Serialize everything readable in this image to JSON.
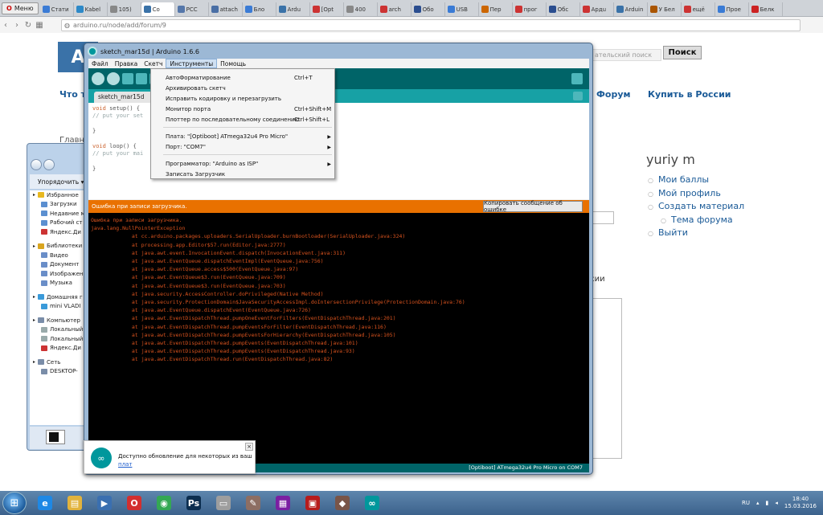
{
  "browser": {
    "menu_label": "Меню",
    "tabs": [
      {
        "label": "Стати",
        "color": "#3a7bd5"
      },
      {
        "label": "Kabel",
        "color": "#2d89c8"
      },
      {
        "label": "105)",
        "color": "#888888"
      },
      {
        "label": "Co",
        "color": "#3a72a8",
        "active": true
      },
      {
        "label": "PCC",
        "color": "#5577aa"
      },
      {
        "label": "attach",
        "color": "#4a6fa5"
      },
      {
        "label": "Бло",
        "color": "#3a7bd5"
      },
      {
        "label": "Ardu",
        "color": "#3a72a8"
      },
      {
        "label": "[Opt",
        "color": "#cc3333"
      },
      {
        "label": "400",
        "color": "#888888"
      },
      {
        "label": "arch",
        "color": "#cc3333"
      },
      {
        "label": "Обо",
        "color": "#2a4d8f"
      },
      {
        "label": "USB",
        "color": "#3a7bd5"
      },
      {
        "label": "Пер",
        "color": "#cc6600"
      },
      {
        "label": "прог",
        "color": "#cc3333"
      },
      {
        "label": "Обс",
        "color": "#2a4d8f"
      },
      {
        "label": "Ардu",
        "color": "#cc3333"
      },
      {
        "label": "Arduin",
        "color": "#3a72a8"
      },
      {
        "label": "У Бел",
        "color": "#aa5500"
      },
      {
        "label": "ещё",
        "color": "#cc3333"
      },
      {
        "label": "Прое",
        "color": "#3a7bd5"
      },
      {
        "label": "Белк",
        "color": "#cc2222"
      }
    ],
    "url": "arduino.ru/node/add/forum/9"
  },
  "page": {
    "search_hint": "ательский поиск",
    "search_button": "Поиск",
    "nav_what": "Что т",
    "nav_forum": "Форум",
    "nav_buy": "Купить в России",
    "crumb": "Главн",
    "user_name": "yuriy m",
    "user_menu": [
      "Мои баллы",
      "Мой профиль",
      "Создать материал",
      "Тема форума",
      "Выйти"
    ],
    "rossii": "осии"
  },
  "explorer": {
    "organize": "Упорядочить ▾",
    "tree": [
      {
        "label": "Избранное",
        "color": "#e8b820",
        "level": 0
      },
      {
        "label": "Загрузки",
        "color": "#5b8fd0",
        "level": 1
      },
      {
        "label": "Недавние м",
        "color": "#5b8fd0",
        "level": 1
      },
      {
        "label": "Рабочий ст",
        "color": "#5b8fd0",
        "level": 1
      },
      {
        "label": "Яндекс.Ди",
        "color": "#cc3333",
        "level": 1
      },
      {
        "label": "",
        "color": "",
        "level": -1
      },
      {
        "label": "Библиотеки",
        "color": "#d9a520",
        "level": 0
      },
      {
        "label": "Видео",
        "color": "#6a8ec8",
        "level": 1
      },
      {
        "label": "Документ",
        "color": "#6a8ec8",
        "level": 1
      },
      {
        "label": "Изображен",
        "color": "#6a8ec8",
        "level": 1
      },
      {
        "label": "Музыка",
        "color": "#6a8ec8",
        "level": 1
      },
      {
        "label": "",
        "color": "",
        "level": -1
      },
      {
        "label": "Домашняя г",
        "color": "#3a9ad9",
        "level": 0
      },
      {
        "label": "mini VLADI",
        "color": "#3a9ad9",
        "level": 1
      },
      {
        "label": "",
        "color": "",
        "level": -1
      },
      {
        "label": "Компьютер",
        "color": "#7a8da8",
        "level": 0
      },
      {
        "label": "Локальный",
        "color": "#9aa",
        "level": 1
      },
      {
        "label": "Локальный",
        "color": "#9aa",
        "level": 1
      },
      {
        "label": "Яндекс.Ди",
        "color": "#cc3333",
        "level": 1
      },
      {
        "label": "",
        "color": "",
        "level": -1
      },
      {
        "label": "Сеть",
        "color": "#7a8da8",
        "level": 0
      },
      {
        "label": "DESKTOP-",
        "color": "#7a8da8",
        "level": 1
      }
    ]
  },
  "arduino": {
    "title": "sketch_mar15d | Arduino 1.6.6",
    "menus": [
      "Файл",
      "Правка",
      "Скетч",
      "Инструменты",
      "Помощь"
    ],
    "tab": "sketch_mar15d",
    "code": [
      {
        "k": "void",
        "rest": " setup() {"
      },
      {
        "c": "  // put your set"
      },
      {
        "t": ""
      },
      {
        "t": "}"
      },
      {
        "t": ""
      },
      {
        "k": "void",
        "rest": " loop() {"
      },
      {
        "c": "  // put your mai"
      },
      {
        "t": ""
      },
      {
        "t": "}"
      }
    ],
    "error_bar": "Ошибка при записи загрузчика.",
    "copy_button": "Копировать сообщение об ошибке",
    "console": [
      "Ошибка при записи загрузчика.",
      "java.lang.NullPointerException",
      "\tat cc.arduino.packages.uploaders.SerialUploader.burnBootloader(SerialUploader.java:324)",
      "\tat processing.app.Editor$57.run(Editor.java:2777)",
      "\tat java.awt.event.InvocationEvent.dispatch(InvocationEvent.java:311)",
      "\tat java.awt.EventQueue.dispatchEventImpl(EventQueue.java:756)",
      "\tat java.awt.EventQueue.access$500(EventQueue.java:97)",
      "\tat java.awt.EventQueue$3.run(EventQueue.java:709)",
      "\tat java.awt.EventQueue$3.run(EventQueue.java:703)",
      "\tat java.security.AccessController.doPrivileged(Native Method)",
      "\tat java.security.ProtectionDomain$JavaSecurityAccessImpl.doIntersectionPrivilege(ProtectionDomain.java:76)",
      "\tat java.awt.EventQueue.dispatchEvent(EventQueue.java:726)",
      "\tat java.awt.EventDispatchThread.pumpOneEventForFilters(EventDispatchThread.java:201)",
      "\tat java.awt.EventDispatchThread.pumpEventsForFilter(EventDispatchThread.java:116)",
      "\tat java.awt.EventDispatchThread.pumpEventsForHierarchy(EventDispatchThread.java:105)",
      "\tat java.awt.EventDispatchThread.pumpEvents(EventDispatchThread.java:101)",
      "\tat java.awt.EventDispatchThread.pumpEvents(EventDispatchThread.java:93)",
      "\tat java.awt.EventDispatchThread.run(EventDispatchThread.java:82)"
    ],
    "status": "[Optiboot] ATmega32u4 Pro Micro on COM7"
  },
  "tools_menu": [
    {
      "label": "АвтоФорматирование",
      "shortcut": "Ctrl+T"
    },
    {
      "label": "Архивировать скетч",
      "shortcut": ""
    },
    {
      "label": "Исправить кодировку и перезагрузить",
      "shortcut": ""
    },
    {
      "label": "Монитор порта",
      "shortcut": "Ctrl+Shift+M"
    },
    {
      "label": "Плоттер по последовательному соединению",
      "shortcut": "Ctrl+Shift+L"
    },
    {
      "label": "Плата: \"[Optiboot] ATmega32u4 Pro Micro\"",
      "shortcut": "",
      "sub": true
    },
    {
      "label": "Порт: \"COM7\"",
      "shortcut": "",
      "sub": true
    },
    {
      "label": "Программатор: \"Arduino as ISP\"",
      "shortcut": "",
      "sub": true
    },
    {
      "label": "Записать Загрузчик",
      "shortcut": ""
    }
  ],
  "notification": {
    "text": "Доступно обновление для некоторых из ваших",
    "link": "плат"
  },
  "taskbar": {
    "apps": [
      {
        "name": "ie-icon",
        "glyph": "e",
        "color": "#1e88e5"
      },
      {
        "name": "explorer-icon",
        "glyph": "▤",
        "color": "#e2b33c"
      },
      {
        "name": "media-player-icon",
        "glyph": "▶",
        "color": "#3a6fb0"
      },
      {
        "name": "opera-icon",
        "glyph": "O",
        "color": "#d32f2f"
      },
      {
        "name": "chrome-icon",
        "glyph": "◉",
        "color": "#34a853"
      },
      {
        "name": "photoshop-icon",
        "glyph": "Ps",
        "color": "#0b2d4e"
      },
      {
        "name": "file-icon",
        "glyph": "▭",
        "color": "#9e9e9e"
      },
      {
        "name": "notes-icon",
        "glyph": "✎",
        "color": "#8d6e63"
      },
      {
        "name": "winrar-icon",
        "glyph": "▦",
        "color": "#7b1fa2"
      },
      {
        "name": "toolbox-icon",
        "glyph": "▣",
        "color": "#b71c1c"
      },
      {
        "name": "package-icon",
        "glyph": "◆",
        "color": "#795548"
      },
      {
        "name": "arduino-icon",
        "glyph": "∞",
        "color": "#00979c"
      }
    ],
    "lang": "RU",
    "time": "18:40",
    "date": "15.03.2016"
  }
}
